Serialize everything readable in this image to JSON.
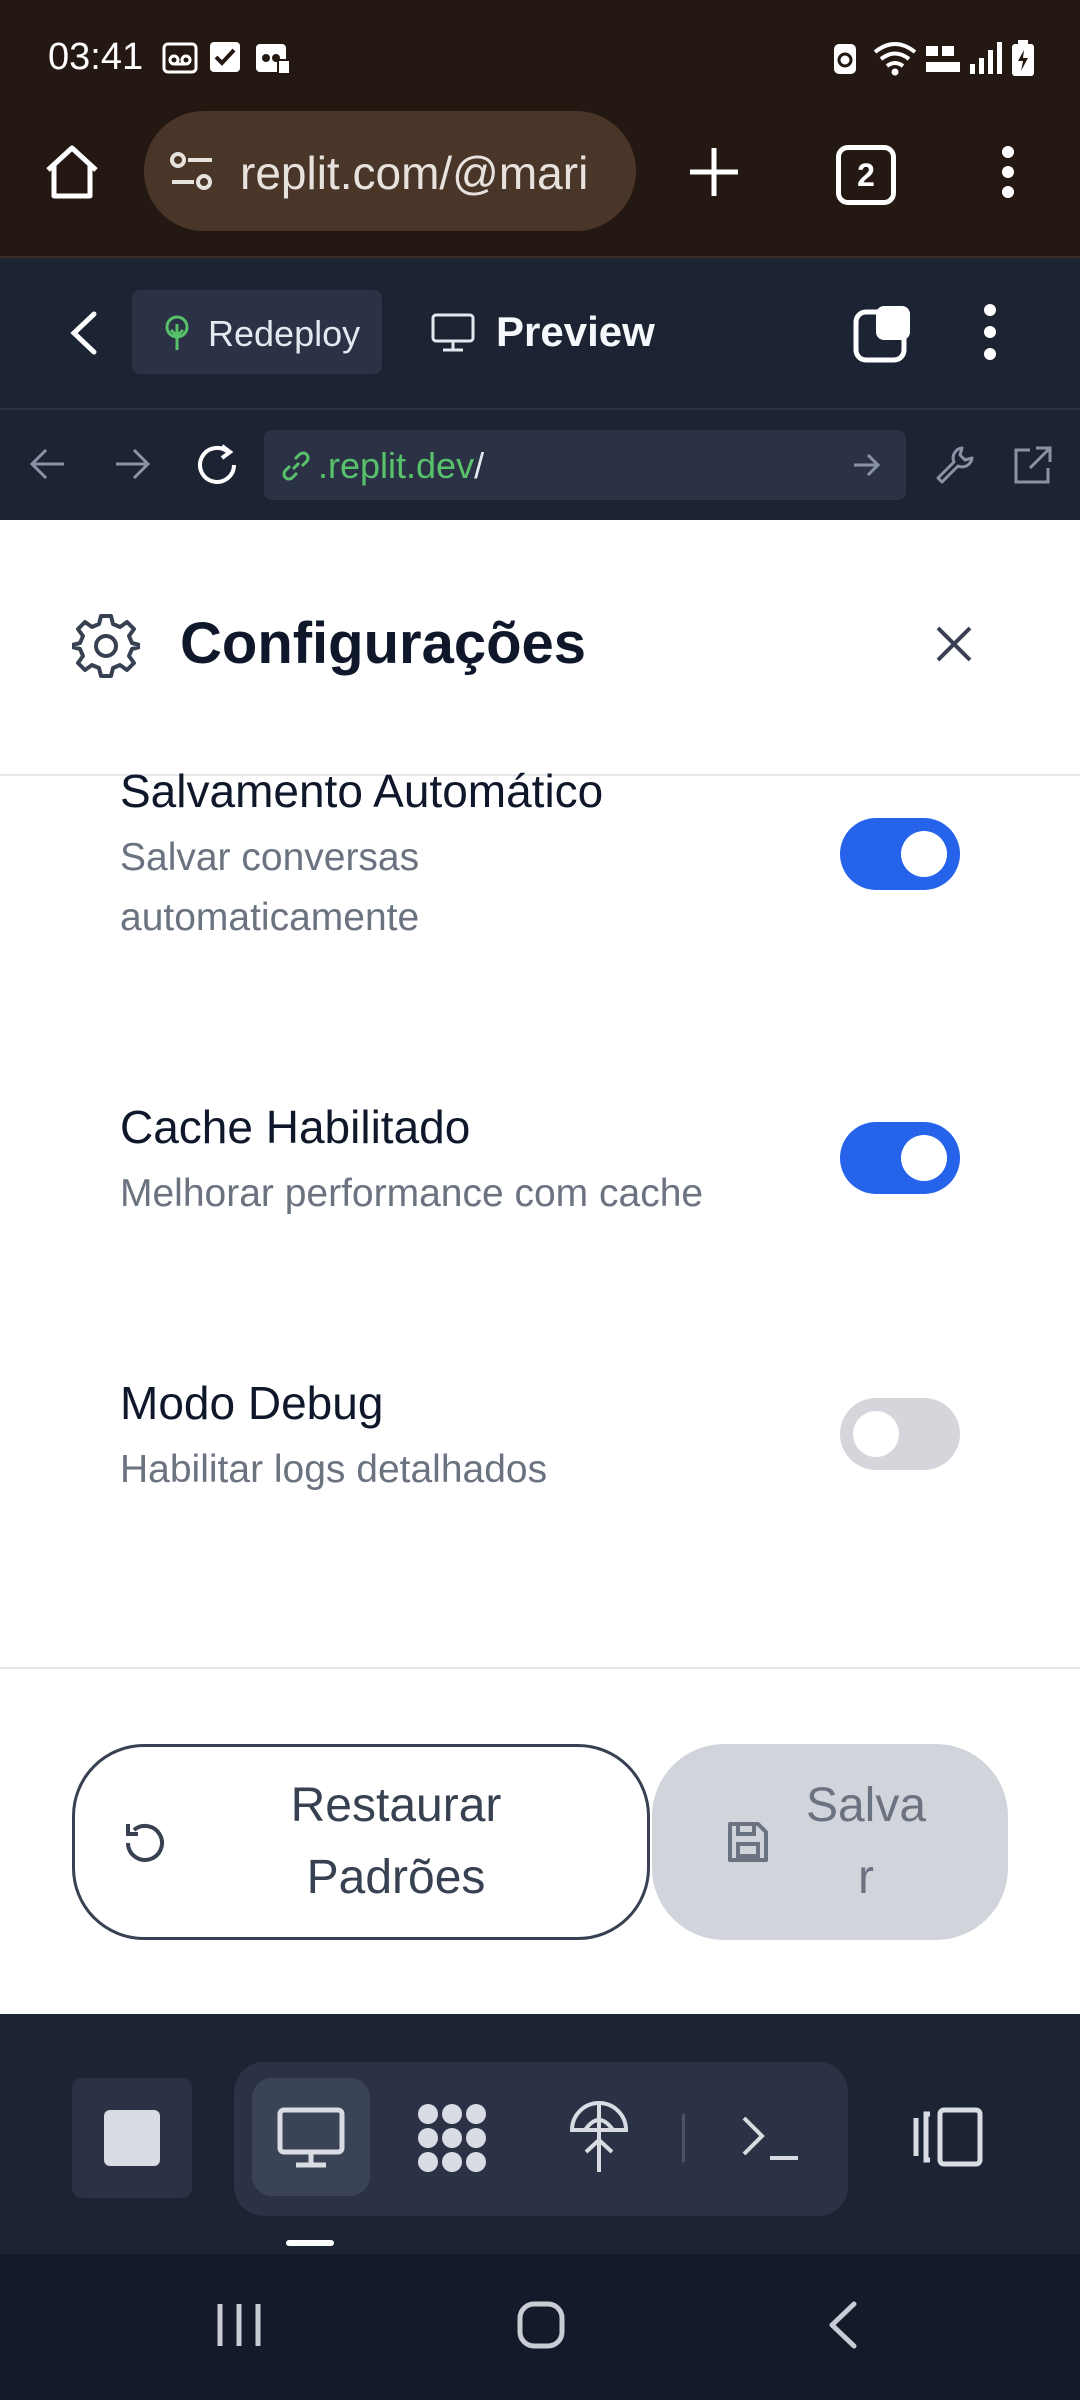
{
  "status_bar": {
    "time": "03:41"
  },
  "browser": {
    "url": "replit.com/@mari",
    "tab_count": "2"
  },
  "replit_header": {
    "redeploy_label": "Redeploy",
    "preview_label": "Preview"
  },
  "dev_bar": {
    "url_domain": ".replit.dev",
    "url_path": "/"
  },
  "settings": {
    "title": "Configurações",
    "items": [
      {
        "title": "Salvamento Automático",
        "desc_line1": "Salvar conversas",
        "desc_line2": "automaticamente",
        "enabled": true
      },
      {
        "title": "Cache Habilitado",
        "desc_line1": "Melhorar performance com cache",
        "enabled": true
      },
      {
        "title": "Modo Debug",
        "desc_line1": "Habilitar logs detalhados",
        "enabled": false
      }
    ],
    "restore_line1": "Restaurar",
    "restore_line2": "Padrões",
    "save_line1": "Salva",
    "save_line2": "r"
  },
  "colors": {
    "toggle_on": "#2563eb",
    "toggle_off": "#d4d6dc",
    "replit_bg": "#1c2333",
    "browser_bg": "#241812",
    "link_green": "#58c26b"
  },
  "icons": {
    "status": [
      "voicemail-icon",
      "checkbox-icon",
      "sim-icon",
      "battery-saver-icon",
      "wifi-icon",
      "volte-icon",
      "signal-icon",
      "battery-icon"
    ],
    "browser": [
      "home-icon",
      "site-settings-icon",
      "plus-icon",
      "tab-switcher-icon",
      "more-vert-icon"
    ],
    "replit_header": [
      "back-chevron-icon",
      "tree-icon",
      "monitor-icon",
      "workspace-icon",
      "more-vert-icon"
    ],
    "dev_bar": [
      "back-arrow-icon",
      "forward-arrow-icon",
      "refresh-icon",
      "link-icon",
      "go-arrow-icon",
      "wrench-icon",
      "external-link-icon"
    ],
    "settings": [
      "gear-icon",
      "close-icon",
      "restore-icon",
      "floppy-disk-icon"
    ],
    "bottom_toolbar": [
      "stop-icon",
      "monitor-icon",
      "agent-icon",
      "deploy-icon",
      "terminal-icon",
      "panels-icon"
    ],
    "nav": [
      "recents-icon",
      "home-circle-icon",
      "back-icon"
    ]
  }
}
